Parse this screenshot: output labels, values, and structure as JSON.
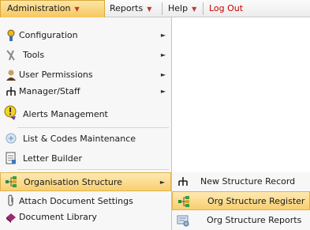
{
  "menubar": {
    "items": [
      {
        "label": "Administration",
        "has_dropdown": true,
        "active": true
      },
      {
        "label": "Reports",
        "has_dropdown": true
      },
      {
        "label": "Help",
        "has_dropdown": true
      },
      {
        "label": "Log Out",
        "has_dropdown": false,
        "color": "#cc0000"
      }
    ]
  },
  "menu": {
    "items": [
      {
        "label": "Configuration",
        "icon": "configuration-icon",
        "has_submenu": true
      },
      {
        "label": "Tools",
        "icon": "tools-icon",
        "has_submenu": true
      },
      {
        "label": "User Permissions",
        "icon": "user-permissions-icon",
        "has_submenu": true
      },
      {
        "label": "Manager/Staff",
        "icon": "hierarchy-icon",
        "has_submenu": true
      },
      {
        "label": "Alerts Management",
        "icon": "alert-icon",
        "has_submenu": false
      },
      {
        "label": "List & Codes Maintenance",
        "icon": "list-codes-icon",
        "has_submenu": false
      },
      {
        "label": "Letter Builder",
        "icon": "letter-icon",
        "has_submenu": false
      },
      {
        "label": "Organisation Structure",
        "icon": "org-structure-icon",
        "has_submenu": true,
        "highlighted": true
      },
      {
        "label": "Attach Document Settings",
        "icon": "paperclip-icon",
        "has_submenu": false
      },
      {
        "label": "Document Library",
        "icon": "book-icon",
        "has_submenu": false
      }
    ]
  },
  "submenu": {
    "items": [
      {
        "label": "New Structure Record",
        "icon": "hierarchy-icon"
      },
      {
        "label": "Org Structure Register",
        "icon": "org-structure-icon",
        "highlighted": true
      },
      {
        "label": "Org Structure Reports",
        "icon": "report-icon"
      }
    ]
  },
  "colors": {
    "highlight": "#f8cf6f",
    "menu_background": "#f7f7f7",
    "logout": "#cc0000"
  }
}
